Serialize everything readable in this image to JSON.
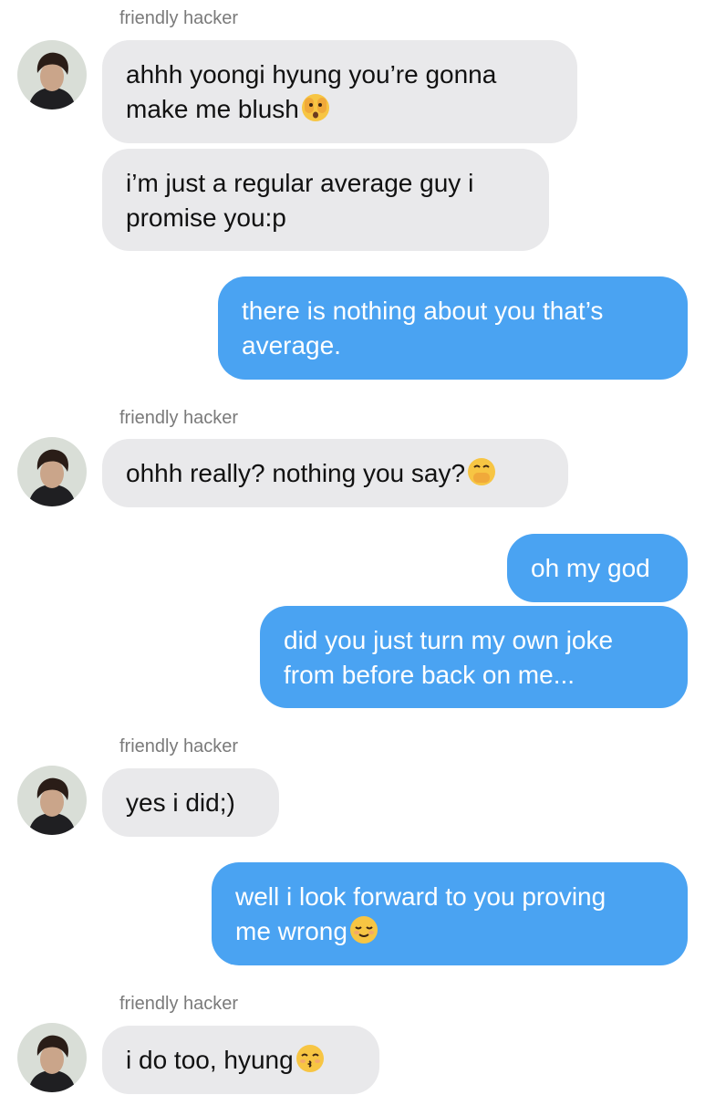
{
  "colors": {
    "incoming_bubble": "#e9e9eb",
    "outgoing_bubble": "#4aa3f2",
    "sender_name": "#7a7a7a",
    "background": "#ffffff"
  },
  "conversation": {
    "groups": [
      {
        "sender": "friendly hacker",
        "messages": [
          {
            "lines": [
              "ahhh yoongi hyung you’re gonna",
              "make me blush"
            ],
            "emoji": "face-peeking-with-eyes"
          },
          {
            "lines": [
              "i’m just a regular average guy i",
              "promise you:p"
            ]
          }
        ]
      },
      {
        "sender": "me",
        "messages": [
          {
            "lines": [
              "there is nothing about you that’s",
              "average."
            ]
          }
        ]
      },
      {
        "sender": "friendly hacker",
        "messages": [
          {
            "lines": [
              "ohhh really? nothing you say?"
            ],
            "emoji": "face-with-hand-over-mouth"
          }
        ]
      },
      {
        "sender": "me",
        "messages": [
          {
            "lines": [
              "oh my god"
            ]
          },
          {
            "lines": [
              "did you just turn my own joke",
              "from before back on me..."
            ]
          }
        ]
      },
      {
        "sender": "friendly hacker",
        "messages": [
          {
            "lines": [
              "yes i did;)"
            ]
          }
        ]
      },
      {
        "sender": "me",
        "messages": [
          {
            "lines": [
              "well i look forward to you proving",
              "me wrong"
            ],
            "emoji": "relieved-face"
          }
        ]
      },
      {
        "sender": "friendly hacker",
        "messages": [
          {
            "lines": [
              "i do too, hyung"
            ],
            "emoji": "kissing-face-with-smiling-eyes"
          }
        ]
      }
    ]
  }
}
